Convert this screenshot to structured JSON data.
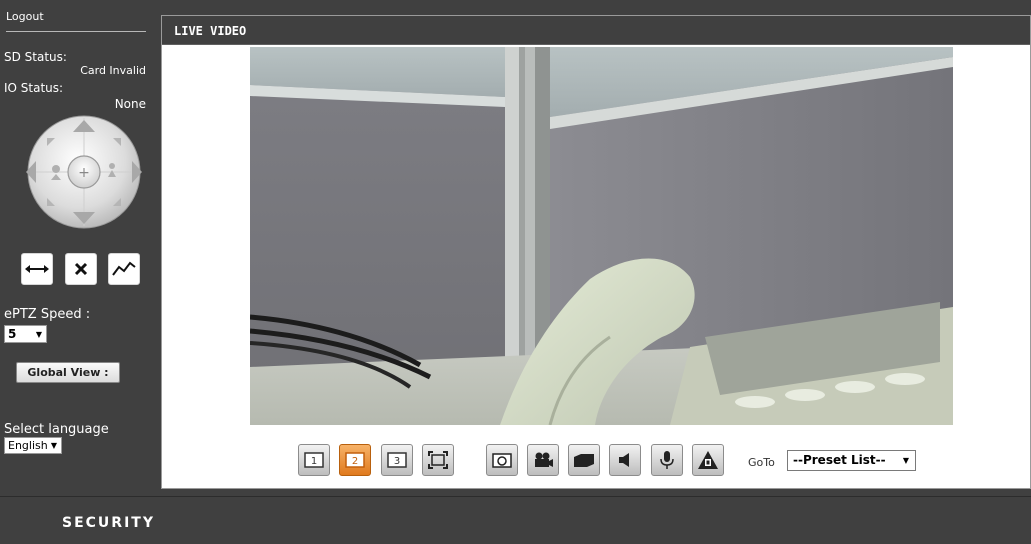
{
  "sidebar": {
    "logout_label": "Logout",
    "sd_status_label": "SD Status:",
    "sd_status_value": "Card Invalid",
    "io_status_label": "IO Status:",
    "io_status_value": "None",
    "ptz_icons": [
      "arrow-up-icon",
      "arrow-down-icon",
      "arrow-left-icon",
      "arrow-right-icon",
      "zoom-in-icon",
      "zoom-out-icon",
      "home-icon"
    ],
    "tool_icons": [
      "horizontal-pan-icon",
      "stop-icon",
      "patrol-path-icon"
    ],
    "eptz_speed_label": "ePTZ Speed :",
    "eptz_speed_value": "5",
    "global_view_label": "Global View :",
    "language_label": "Select language",
    "language_value": "English"
  },
  "main": {
    "title": "LIVE VIDEO",
    "view_modes": [
      "1",
      "2",
      "3"
    ],
    "active_view_mode": "2",
    "control_icons": [
      "fullscreen-icon",
      "snapshot-icon",
      "record-video-icon",
      "folder-icon",
      "speaker-icon",
      "microphone-icon",
      "alarm-icon"
    ],
    "goto_label": "GoTo",
    "preset_value": "--Preset List--"
  },
  "footer": {
    "brand": "SECURITY"
  },
  "colors": {
    "background": "#404040",
    "accent": "#e58a2c",
    "panel": "#ffffff"
  }
}
